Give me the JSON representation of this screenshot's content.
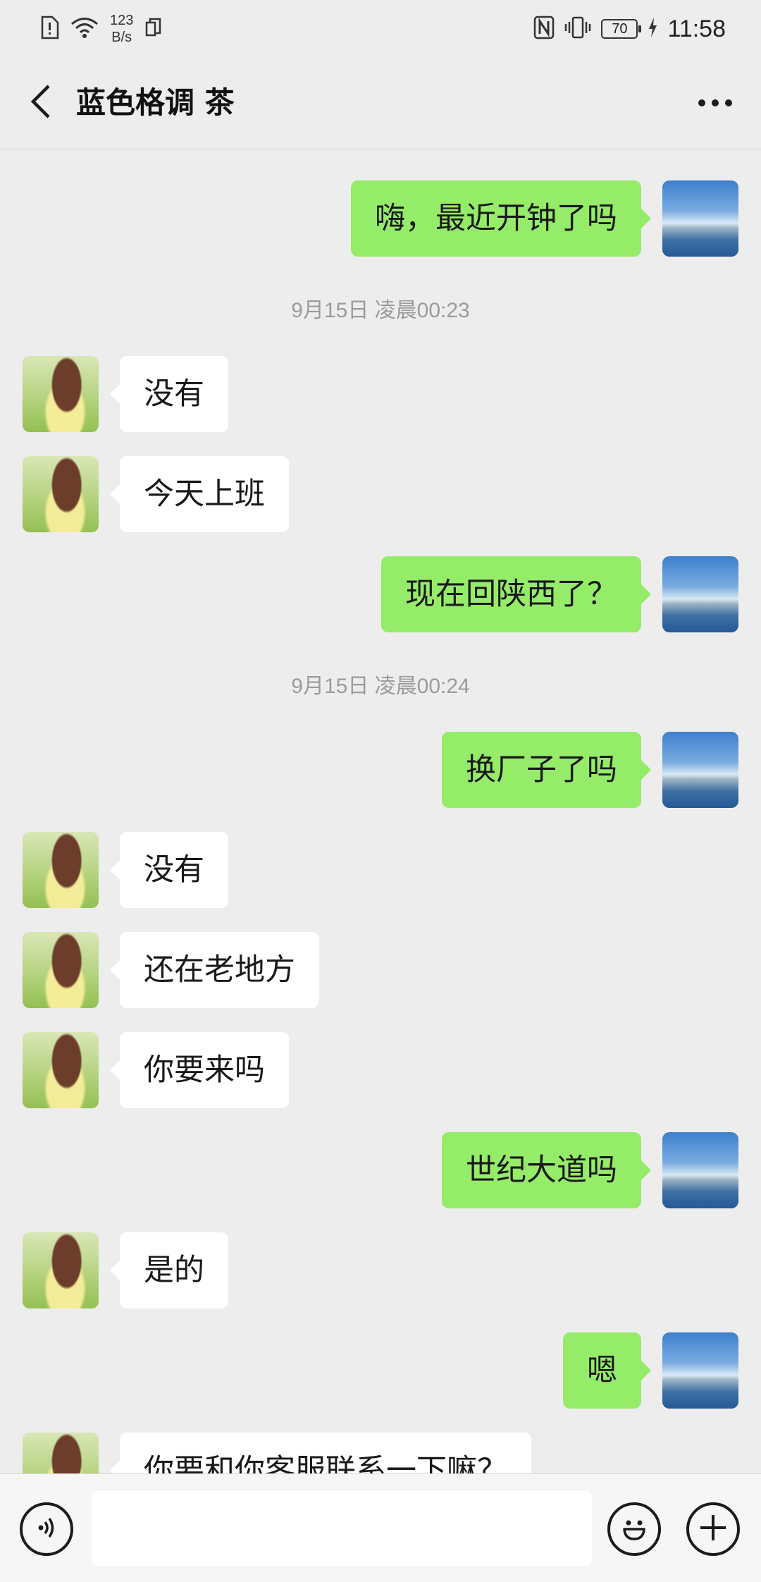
{
  "status_bar": {
    "net_speed_value": "123",
    "net_speed_unit": "B/s",
    "battery": "70",
    "time": "11:58"
  },
  "header": {
    "title": "蓝色格调 茶"
  },
  "chat": {
    "messages": [
      {
        "side": "out",
        "text": "嗨，最近开钟了吗"
      },
      {
        "side": "stamp",
        "text": "9月15日 凌晨00:23"
      },
      {
        "side": "in",
        "text": "没有"
      },
      {
        "side": "in",
        "text": "今天上班"
      },
      {
        "side": "out",
        "text": "现在回陕西了？"
      },
      {
        "side": "stamp",
        "text": "9月15日 凌晨00:24"
      },
      {
        "side": "out",
        "text": "换厂子了吗"
      },
      {
        "side": "in",
        "text": "没有"
      },
      {
        "side": "in",
        "text": "还在老地方"
      },
      {
        "side": "in",
        "text": "你要来吗"
      },
      {
        "side": "out",
        "text": "世纪大道吗"
      },
      {
        "side": "in",
        "text": "是的"
      },
      {
        "side": "out",
        "text": "嗯"
      },
      {
        "side": "in",
        "text": "你要和你客服联系一下嘛？"
      }
    ]
  },
  "input_bar": {
    "text_value": "",
    "placeholder": ""
  },
  "colors": {
    "background": "#ededed",
    "outgoing_bubble": "#95ec69",
    "incoming_bubble": "#ffffff",
    "timestamp_text": "#9b9b9b"
  },
  "icons": [
    "back-arrow-icon",
    "more-icon",
    "voice-icon",
    "emoji-icon",
    "plus-icon",
    "wifi-icon",
    "nfc-icon",
    "vibrate-icon",
    "charging-icon"
  ]
}
